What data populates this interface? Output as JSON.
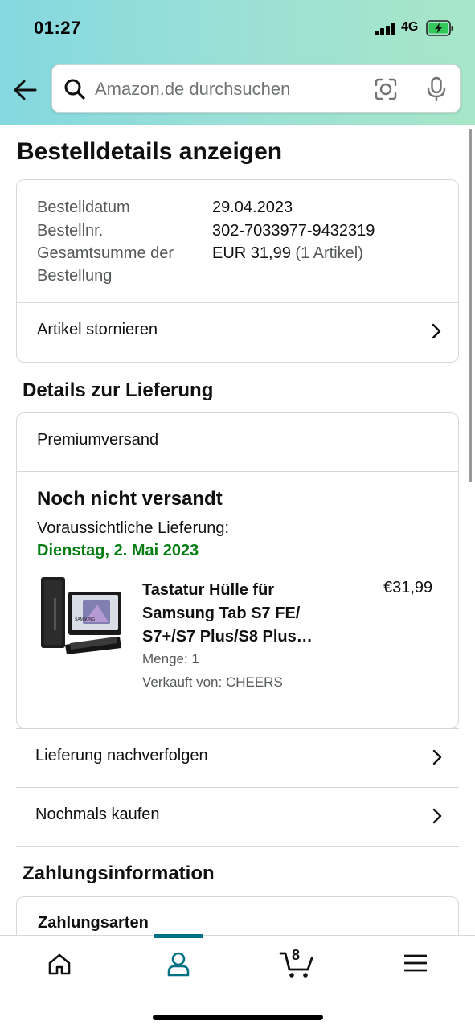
{
  "status_bar": {
    "time": "01:27",
    "network": "4G"
  },
  "search": {
    "placeholder": "Amazon.de durchsuchen",
    "value": ""
  },
  "page_title": "Bestelldetails anzeigen",
  "order_summary": {
    "rows": [
      {
        "label": "Bestelldatum",
        "value": "29.04.2023"
      },
      {
        "label": "Bestellnr.",
        "value": "302-7033977-9432319"
      },
      {
        "label": "Gesamtsumme der Bestellung",
        "value": "EUR 31,99",
        "value_sub": "(1 Artikel)"
      }
    ],
    "cancel_link": "Artikel stornieren"
  },
  "delivery_section": {
    "title": "Details zur Lieferung",
    "shipping_type": "Premiumversand",
    "status": "Noch nicht versandt",
    "expected_label": "Voraussichtliche Lieferung:",
    "expected_date": "Dienstag, 2. Mai 2023",
    "item": {
      "title": "Tastatur Hülle für Samsung Tab S7 FE/ S7+/S7 Plus/S8 Plus…",
      "price": "€31,99",
      "quantity": "Menge: 1",
      "seller": "Verkauft von: CHEERS"
    }
  },
  "actions": {
    "track": "Lieferung nachverfolgen",
    "buy_again": "Nochmals kaufen"
  },
  "payment_section": {
    "title": "Zahlungsinformation",
    "subtitle": "Zahlungsarten"
  },
  "bottom_nav": {
    "cart_count": "8"
  },
  "colors": {
    "accent": "#007185",
    "delivery_green": "#067d12",
    "header_start": "#84d8e0",
    "header_end": "#a7e6c8"
  }
}
